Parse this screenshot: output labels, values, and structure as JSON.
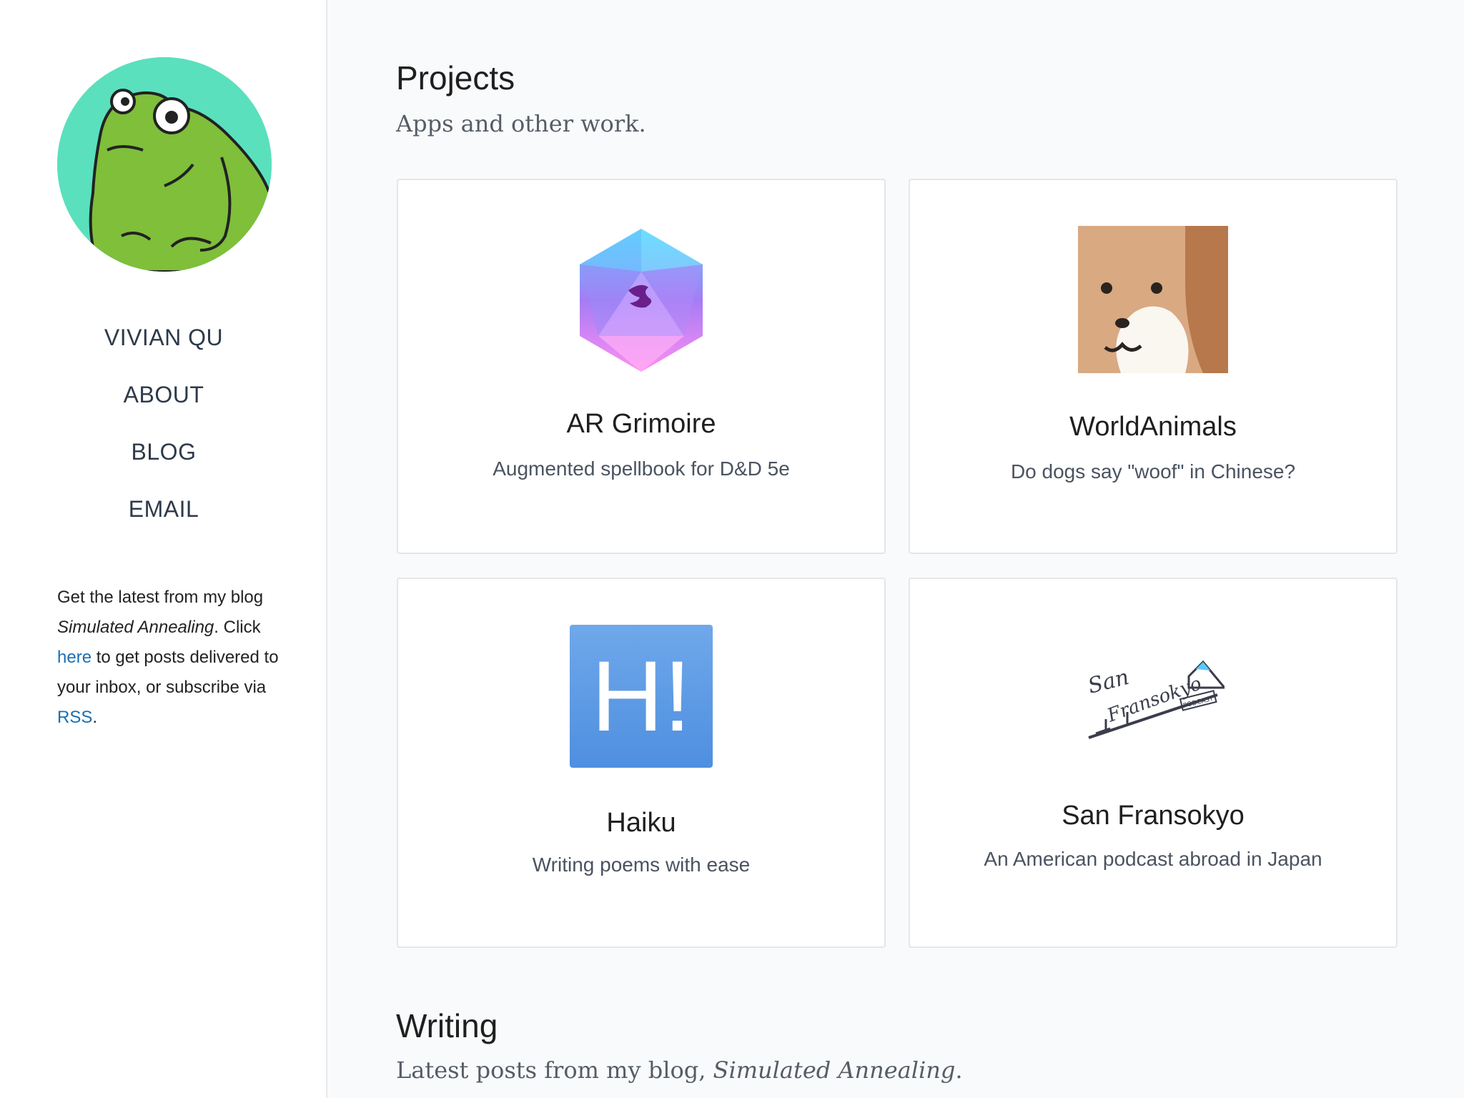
{
  "sidebar": {
    "nav": [
      {
        "label": "VIVIAN QU"
      },
      {
        "label": "ABOUT"
      },
      {
        "label": "BLOG"
      },
      {
        "label": "EMAIL"
      }
    ],
    "blurb": {
      "line1": "Get the latest from my blog ",
      "blog_name": "Simulated Annealing",
      "period": ".",
      "click": " Click ",
      "here_link": "here",
      "mid": " to get posts delivered to your inbox, or subscribe via ",
      "rss_link": "RSS",
      "end": "."
    }
  },
  "projects": {
    "title": "Projects",
    "subtitle": "Apps and other work.",
    "cards": [
      {
        "name": "AR Grimoire",
        "desc": "Augmented spellbook for D&D 5e",
        "icon": "d20-dice-icon"
      },
      {
        "name": "WorldAnimals",
        "desc": "Do dogs say \"woof\" in Chinese?",
        "icon": "dog-face-icon"
      },
      {
        "name": "Haiku",
        "desc": "Writing poems with ease",
        "icon": "haiku-h-icon"
      },
      {
        "name": "San Fransokyo",
        "desc": "An American podcast abroad in Japan",
        "icon": "san-fransokyo-logo"
      }
    ]
  },
  "writing": {
    "title": "Writing",
    "subtitle_prefix": "Latest posts from my blog, ",
    "subtitle_blog": "Simulated Annealing",
    "subtitle_end": "."
  },
  "logo_text": {
    "san_fransokyo_script": "San Fransokyo",
    "podcast_tag": "PODCAST",
    "haiku_letter": "H!"
  }
}
